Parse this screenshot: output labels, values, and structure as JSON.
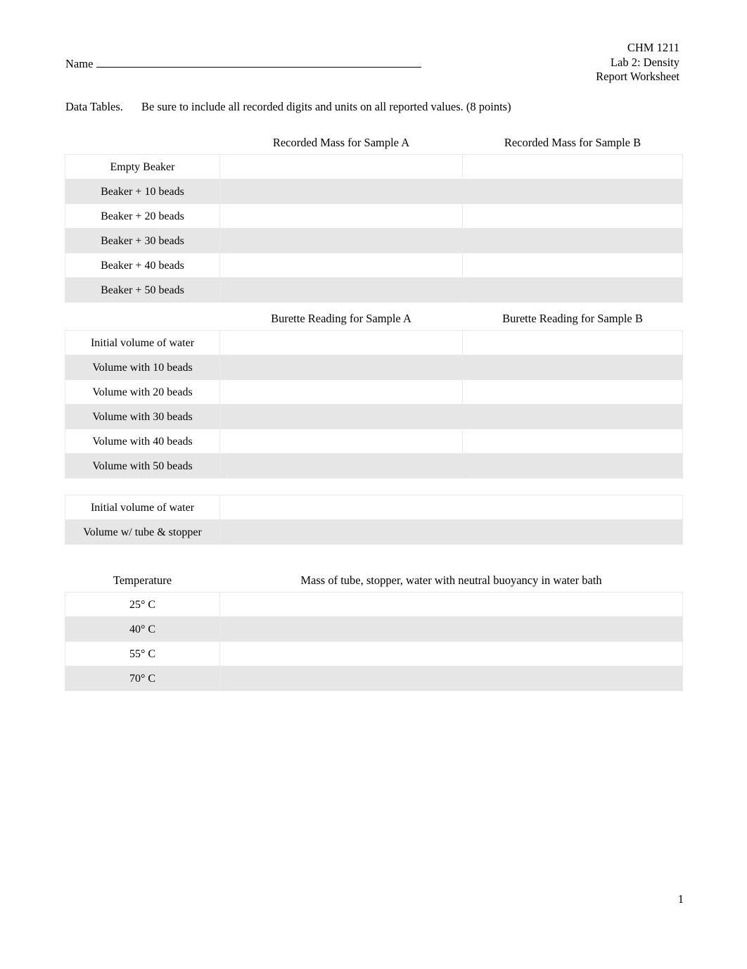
{
  "document": {
    "course_code": "CHM 1211",
    "lab_title": "Lab 2: Density",
    "doc_type": "Report Worksheet",
    "name_label": "Name",
    "page_number": "1"
  },
  "instruction": {
    "lead": "Data Tables.",
    "text": "Be sure to include all recorded digits and units on all reported values. (8 points)"
  },
  "tables": {
    "mass": {
      "headers": [
        "",
        "Recorded Mass for Sample A",
        "Recorded Mass for Sample B"
      ],
      "rows": [
        {
          "label": "Empty Beaker",
          "sample_a": "",
          "sample_b": ""
        },
        {
          "label": "Beaker + 10 beads",
          "sample_a": "",
          "sample_b": ""
        },
        {
          "label": "Beaker + 20 beads",
          "sample_a": "",
          "sample_b": ""
        },
        {
          "label": "Beaker + 30 beads",
          "sample_a": "",
          "sample_b": ""
        },
        {
          "label": "Beaker + 40 beads",
          "sample_a": "",
          "sample_b": ""
        },
        {
          "label": "Beaker + 50 beads",
          "sample_a": "",
          "sample_b": ""
        }
      ]
    },
    "burette": {
      "headers": [
        "",
        "Burette Reading for Sample A",
        "Burette Reading for Sample B"
      ],
      "rows": [
        {
          "label": "Initial volume of water",
          "sample_a": "",
          "sample_b": ""
        },
        {
          "label": "Volume with 10 beads",
          "sample_a": "",
          "sample_b": ""
        },
        {
          "label": "Volume with 20 beads",
          "sample_a": "",
          "sample_b": ""
        },
        {
          "label": "Volume with 30 beads",
          "sample_a": "",
          "sample_b": ""
        },
        {
          "label": "Volume with 40 beads",
          "sample_a": "",
          "sample_b": ""
        },
        {
          "label": "Volume with 50 beads",
          "sample_a": "",
          "sample_b": ""
        }
      ]
    },
    "tube": {
      "rows": [
        {
          "label": "Initial volume of water",
          "value": ""
        },
        {
          "label": "Volume w/ tube & stopper",
          "value": ""
        }
      ]
    },
    "temperature": {
      "headers": [
        "Temperature",
        "Mass of tube, stopper, water with neutral buoyancy in water bath"
      ],
      "rows": [
        {
          "label": "25° C",
          "value": ""
        },
        {
          "label": "40° C",
          "value": ""
        },
        {
          "label": "55° C",
          "value": ""
        },
        {
          "label": "70° C",
          "value": ""
        }
      ]
    }
  }
}
